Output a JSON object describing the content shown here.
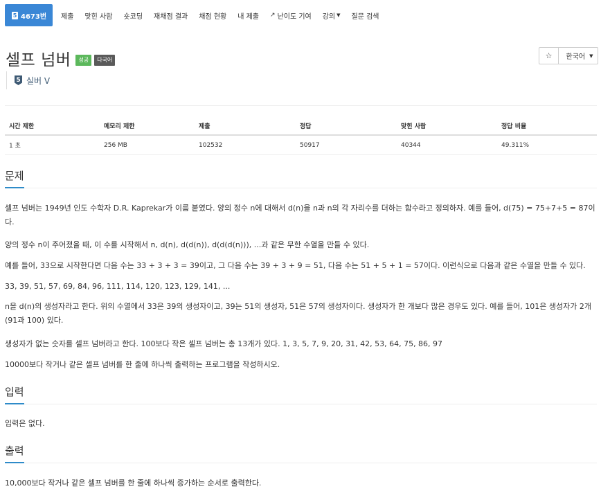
{
  "nav": {
    "problem_badge": "5",
    "problem_id": "4673번",
    "tabs": [
      "제출",
      "맞힌 사람",
      "숏코딩",
      "재채점 결과",
      "채점 현황",
      "내 제출"
    ],
    "difficulty": "난이도 기여",
    "lecture": "강의",
    "question_search": "질문 검색"
  },
  "problem": {
    "title": "셀프 넘버",
    "label_success": "성공",
    "label_multilang": "다국어",
    "tier_number": "5",
    "tier": "실버 V"
  },
  "toolbar": {
    "star": "☆",
    "language": "한국어"
  },
  "stats": {
    "headers": [
      "시간 제한",
      "메모리 제한",
      "제출",
      "정답",
      "맞힌 사람",
      "정답 비율"
    ],
    "values": [
      "1 초",
      "256 MB",
      "102532",
      "50917",
      "40344",
      "49.311%"
    ]
  },
  "sections": {
    "problem": {
      "title": "문제",
      "paragraphs": [
        "셀프 넘버는 1949년 인도 수학자 D.R. Kaprekar가 이름 붙였다. 양의 정수 n에 대해서 d(n)을 n과 n의 각 자리수를 더하는 함수라고 정의하자. 예를 들어, d(75) = 75+7+5 = 87이다.",
        "양의 정수 n이 주어졌을 때, 이 수를 시작해서 n, d(n), d(d(n)), d(d(d(n))), ...과 같은 무한 수열을 만들 수 있다.",
        "예를 들어, 33으로 시작한다면 다음 수는 33 + 3 + 3 = 39이고, 그 다음 수는 39 + 3 + 9 = 51, 다음 수는 51 + 5 + 1 = 57이다. 이런식으로 다음과 같은 수열을 만들 수 있다.",
        "33, 39, 51, 57, 69, 84, 96, 111, 114, 120, 123, 129, 141, ...",
        "n을 d(n)의 생성자라고 한다. 위의 수열에서 33은 39의 생성자이고, 39는 51의 생성자, 51은 57의 생성자이다. 생성자가 한 개보다 많은 경우도 있다. 예를 들어, 101은 생성자가 2개(91과 100) 있다.",
        "생성자가 없는 숫자를 셀프 넘버라고 한다. 100보다 작은 셀프 넘버는 총 13개가 있다. 1, 3, 5, 7, 9, 20, 31, 42, 53, 64, 75, 86, 97",
        "10000보다 작거나 같은 셀프 넘버를 한 줄에 하나씩 출력하는 프로그램을 작성하시오."
      ]
    },
    "input": {
      "title": "입력",
      "text": "입력은 없다."
    },
    "output": {
      "title": "출력",
      "text": "10,000보다 작거나 같은 셀프 넘버를 한 줄에 하나씩 증가하는 순서로 출력한다."
    }
  }
}
